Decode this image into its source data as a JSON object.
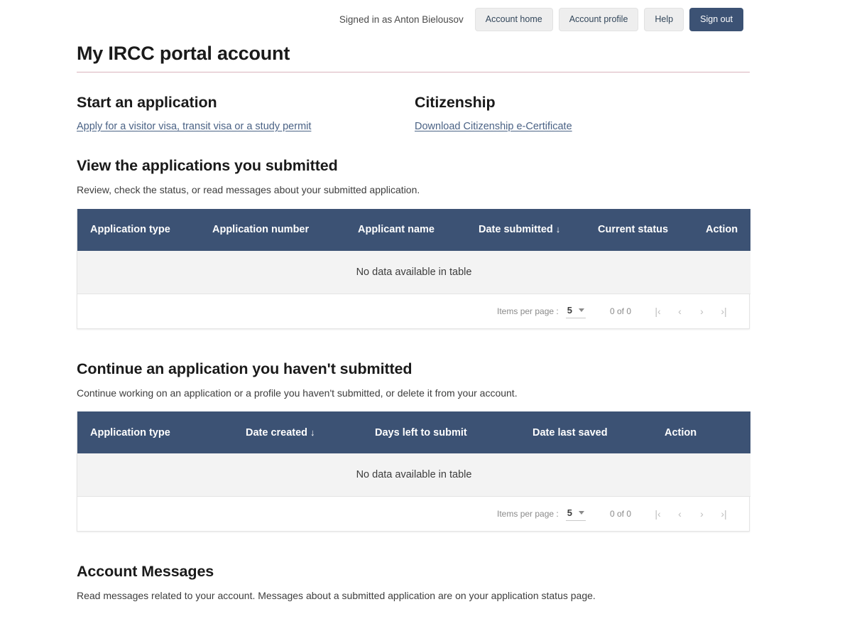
{
  "topbar": {
    "signed_in_text": "Signed in as Anton Bielousov",
    "buttons": [
      {
        "label": "Account home",
        "icon": "home-icon",
        "primary": false
      },
      {
        "label": "Account profile",
        "icon": "profile-icon",
        "primary": false
      },
      {
        "label": "Help",
        "icon": "help-icon",
        "primary": false
      },
      {
        "label": "Sign out",
        "icon": "signout-icon",
        "primary": true
      }
    ]
  },
  "page_title": "My IRCC portal account",
  "start_application": {
    "heading": "Start an application",
    "link": "Apply for a visitor visa, transit visa or a study permit"
  },
  "citizenship": {
    "heading": "Citizenship",
    "link": "Download Citizenship e-Certificate"
  },
  "submitted_section": {
    "heading": "View the applications you submitted",
    "description": "Review, check the status, or read messages about your submitted application.",
    "columns": [
      "Application type",
      "Application number",
      "Applicant name",
      "Date submitted",
      "Current status",
      "Action"
    ],
    "sorted_column": "Date submitted",
    "sort_arrow": "↓",
    "empty_message": "No data available in table",
    "paginator": {
      "items_per_page_label": "Items per page :",
      "items_per_page_value": "5",
      "range_label": "0 of 0",
      "first_arrow": "|‹",
      "prev_arrow": "‹",
      "next_arrow": "›",
      "last_arrow": "›|"
    }
  },
  "continue_section": {
    "heading": "Continue an application you haven't submitted",
    "description": "Continue working on an application or a profile you haven't submitted, or delete it from your account.",
    "columns": [
      "Application type",
      "Date created",
      "Days left to submit",
      "Date last saved",
      "Action"
    ],
    "sorted_column": "Date created",
    "sort_arrow": "↓",
    "empty_message": "No data available in table",
    "paginator": {
      "items_per_page_label": "Items per page :",
      "items_per_page_value": "5",
      "range_label": "0 of 0",
      "first_arrow": "|‹",
      "prev_arrow": "‹",
      "next_arrow": "›",
      "last_arrow": "›|"
    }
  },
  "messages_section": {
    "heading": "Account Messages",
    "description": "Read messages related to your account. Messages about a submitted application are on your application status page."
  },
  "colors": {
    "table_header_bg": "#3c5274",
    "primary_button_bg": "#3c5274",
    "link": "#4a6285",
    "title_rule": "#d9b3bd",
    "empty_row_bg": "#f3f3f3"
  }
}
